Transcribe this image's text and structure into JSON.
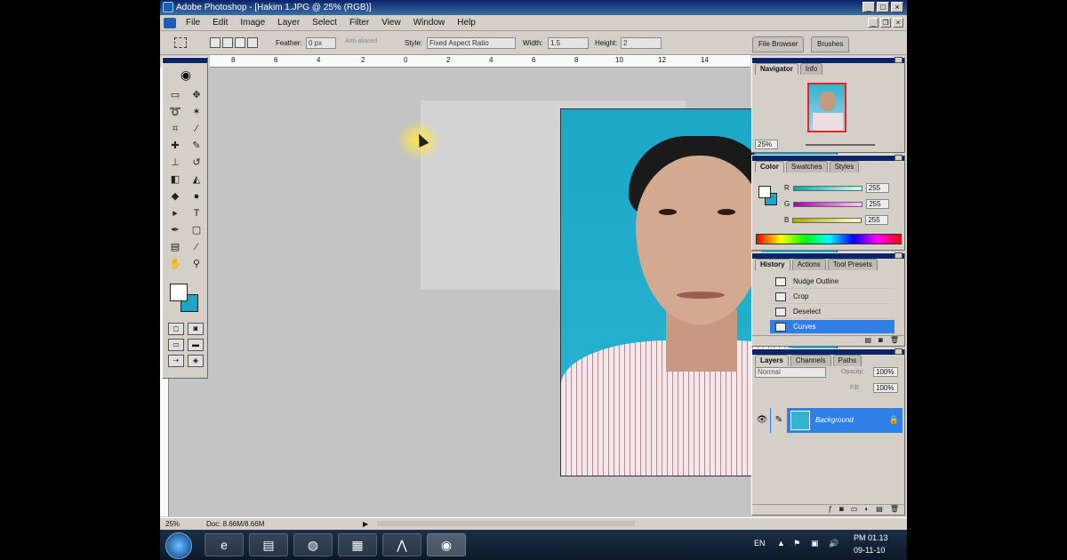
{
  "window": {
    "title": "Adobe Photoshop - [Hakim 1.JPG @ 25% (RGB)]"
  },
  "menu": [
    "File",
    "Edit",
    "Image",
    "Layer",
    "Select",
    "Filter",
    "View",
    "Window",
    "Help"
  ],
  "options": {
    "feather_label": "Feather:",
    "feather_value": "0 px",
    "antialiased": "Anti-aliased",
    "style_label": "Style:",
    "style_value": "Fixed Aspect Ratio",
    "width_label": "Width:",
    "width_value": "1.5",
    "height_label": "Height:",
    "height_value": "2"
  },
  "palette_well": [
    "File Browser",
    "Brushes"
  ],
  "ruler_ticks": [
    "8",
    "6",
    "4",
    "2",
    "0",
    "2",
    "4",
    "6",
    "8",
    "10",
    "12",
    "14"
  ],
  "navigator": {
    "tabs": [
      "Navigator",
      "Info"
    ],
    "zoom": "25%"
  },
  "color": {
    "tabs": [
      "Color",
      "Swatches",
      "Styles"
    ],
    "channels": [
      {
        "label": "R",
        "value": "255",
        "gradient": "linear-gradient(90deg,#0aa,#cff)"
      },
      {
        "label": "G",
        "value": "255",
        "gradient": "linear-gradient(90deg,#a0a,#fcf)"
      },
      {
        "label": "B",
        "value": "255",
        "gradient": "linear-gradient(90deg,#aa0,#ffc)"
      }
    ]
  },
  "history": {
    "tabs": [
      "History",
      "Actions",
      "Tool Presets"
    ],
    "items": [
      "Nudge Outline",
      "Crop",
      "Deselect",
      "Curves"
    ],
    "selected_index": 3
  },
  "layers": {
    "tabs": [
      "Layers",
      "Channels",
      "Paths"
    ],
    "blend_mode": "Normal",
    "opacity_label": "Opacity:",
    "opacity_value": "100%",
    "fill_label": "Fill:",
    "fill_value": "100%",
    "layer_name": "Background"
  },
  "status": {
    "zoom": "25%",
    "doc": "Doc: 8.66M/8.66M"
  },
  "taskbar": {
    "lang": "EN",
    "time": "PM 01.13",
    "date": "09-11-10"
  },
  "colors": {
    "background_swatch": "#1ea6c4",
    "selection": "#2f7fe6",
    "titlebar": "#0a246a"
  }
}
